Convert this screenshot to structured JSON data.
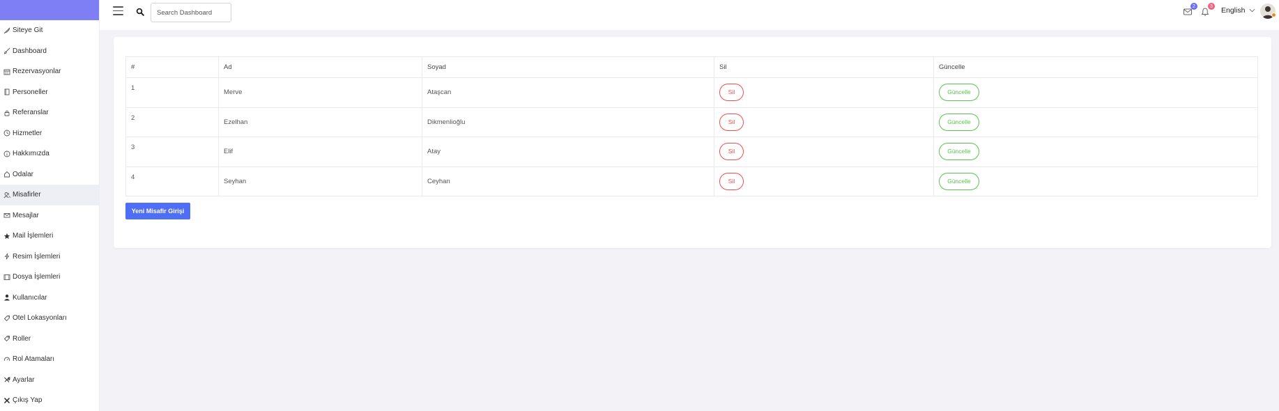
{
  "sidebar": {
    "items": [
      {
        "label": "Siteye Git",
        "icon": "rocket-icon"
      },
      {
        "label": "Dashboard",
        "icon": "brush-icon"
      },
      {
        "label": "Rezervasyonlar",
        "icon": "calendar-icon"
      },
      {
        "label": "Personeller",
        "icon": "book-icon"
      },
      {
        "label": "Referanslar",
        "icon": "lock-icon"
      },
      {
        "label": "Hizmetler",
        "icon": "clock-icon"
      },
      {
        "label": "Hakkımızda",
        "icon": "info-icon"
      },
      {
        "label": "Odalar",
        "icon": "home-icon"
      },
      {
        "label": "Misafirler",
        "icon": "users-icon"
      },
      {
        "label": "Mesajlar",
        "icon": "mail-icon"
      },
      {
        "label": "Mail İşlemleri",
        "icon": "star-icon"
      },
      {
        "label": "Resim İşlemleri",
        "icon": "bolt-icon"
      },
      {
        "label": "Dosya İşlemleri",
        "icon": "film-icon"
      },
      {
        "label": "Kullanıcılar",
        "icon": "user-icon"
      },
      {
        "label": "Otel Lokasyonları",
        "icon": "tag-icon"
      },
      {
        "label": "Roller",
        "icon": "tag-outline-icon"
      },
      {
        "label": "Rol Atamaları",
        "icon": "gauge-icon"
      },
      {
        "label": "Ayarlar",
        "icon": "tools-icon"
      },
      {
        "label": "Çıkış Yap",
        "icon": "close-icon"
      }
    ],
    "active_index": 8
  },
  "header": {
    "search_placeholder": "Search Dashboard",
    "mail_badge": "2",
    "notification_badge": "3",
    "language": "English",
    "colors": {
      "mail_badge": "#6c6ff5",
      "notification_badge": "#f0637d"
    }
  },
  "table": {
    "columns": [
      "#",
      "Ad",
      "Soyad",
      "Sil",
      "Güncelle"
    ],
    "rows": [
      {
        "num": "1",
        "ad": "Merve",
        "soyad": "Ataşcan",
        "sil": "Sil",
        "guncelle": "Güncelle"
      },
      {
        "num": "2",
        "ad": "Ezelhan",
        "soyad": "Dikmenlioğlu",
        "sil": "Sil",
        "guncelle": "Güncelle"
      },
      {
        "num": "3",
        "ad": "Elif",
        "soyad": "Atay",
        "sil": "Sil",
        "guncelle": "Güncelle"
      },
      {
        "num": "4",
        "ad": "Seyhan",
        "soyad": "Ceyhan",
        "sil": "Sil",
        "guncelle": "Güncelle"
      }
    ]
  },
  "new_button_label": "Yeni Misafir Girişi"
}
